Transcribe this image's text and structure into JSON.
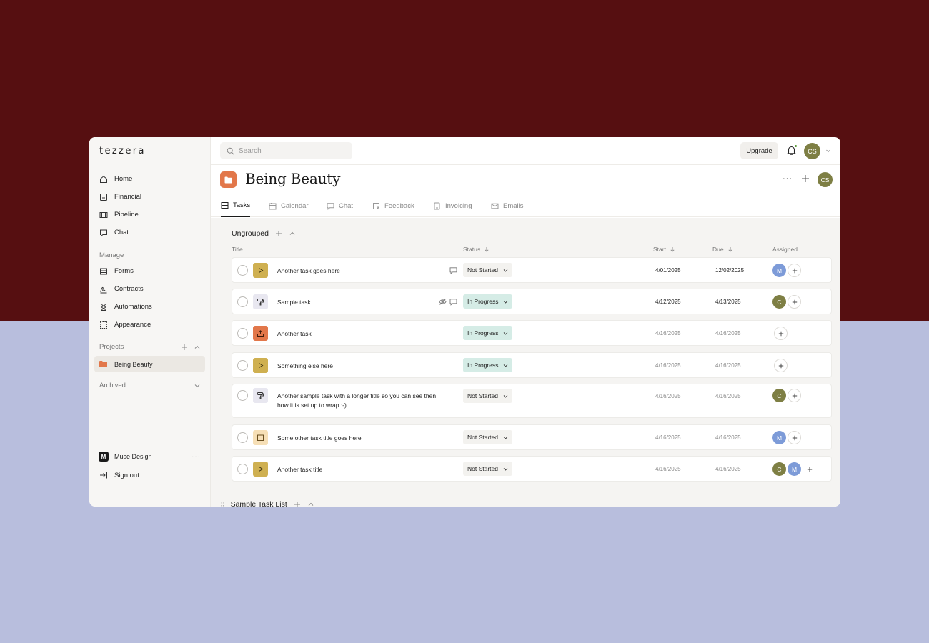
{
  "app": {
    "logo": "tezzera"
  },
  "sidebar": {
    "nav": [
      {
        "label": "Home",
        "icon": "home-icon"
      },
      {
        "label": "Financial",
        "icon": "financial-icon"
      },
      {
        "label": "Pipeline",
        "icon": "pipeline-icon"
      },
      {
        "label": "Chat",
        "icon": "chat-icon"
      }
    ],
    "manage_label": "Manage",
    "manage": [
      {
        "label": "Forms",
        "icon": "forms-icon"
      },
      {
        "label": "Contracts",
        "icon": "contracts-icon"
      },
      {
        "label": "Automations",
        "icon": "hourglass-icon"
      },
      {
        "label": "Appearance",
        "icon": "appearance-icon"
      }
    ],
    "projects_label": "Projects",
    "project": "Being Beauty",
    "archived_label": "Archived",
    "workspace_badge": "M",
    "workspace": "Muse Design",
    "signout": "Sign out"
  },
  "topbar": {
    "search_placeholder": "Search",
    "upgrade": "Upgrade",
    "user_initials": "CS"
  },
  "header": {
    "title": "Being Beauty",
    "avatar": "CS"
  },
  "tabs": [
    {
      "label": "Tasks",
      "active": true
    },
    {
      "label": "Calendar"
    },
    {
      "label": "Chat"
    },
    {
      "label": "Feedback"
    },
    {
      "label": "Invoicing"
    },
    {
      "label": "Emails"
    }
  ],
  "group": {
    "name": "Ungrouped",
    "columns": {
      "title": "Title",
      "status": "Status",
      "start": "Start",
      "due": "Due",
      "assigned": "Assigned"
    }
  },
  "tasks": [
    {
      "title": "Another task goes here",
      "icon": "play-icon",
      "status": "Not Started",
      "start": "4/01/2025",
      "due": "12/02/2025",
      "assigned": [
        "M"
      ]
    },
    {
      "title": "Sample task",
      "icon": "paint-roller-icon",
      "status": "In Progress",
      "start": "4/12/2025",
      "due": "4/13/2025",
      "assigned": [
        "C"
      ]
    },
    {
      "title": "Another task",
      "icon": "upload-icon",
      "status": "In Progress",
      "start": "4/16/2025",
      "due": "4/16/2025",
      "assigned": []
    },
    {
      "title": "Something else here",
      "icon": "play-icon",
      "status": "In Progress",
      "start": "4/16/2025",
      "due": "4/16/2025",
      "assigned": []
    },
    {
      "title_line1": "Another sample task with a longer title so you can see then",
      "title_line2": "how it is set up to wrap :-)",
      "icon": "paint-roller-icon",
      "status": "Not Started",
      "start": "4/16/2025",
      "due": "4/16/2025",
      "assigned": [
        "C"
      ]
    },
    {
      "title": "Some other task title goes here",
      "icon": "calendar-icon",
      "status": "Not Started",
      "start": "4/16/2025",
      "due": "4/16/2025",
      "assigned": [
        "M"
      ]
    },
    {
      "title": "Another task title",
      "icon": "play-icon",
      "status": "Not Started",
      "start": "4/16/2025",
      "due": "4/16/2025",
      "assigned": [
        "C",
        "M"
      ]
    }
  ],
  "next_group": "Sample Task List",
  "colors": {
    "accent_orange": "#e2774a",
    "in_progress_bg": "#d5ece6",
    "avatar_olive": "#7e7f44",
    "avatar_blue": "#7d9bd8"
  }
}
